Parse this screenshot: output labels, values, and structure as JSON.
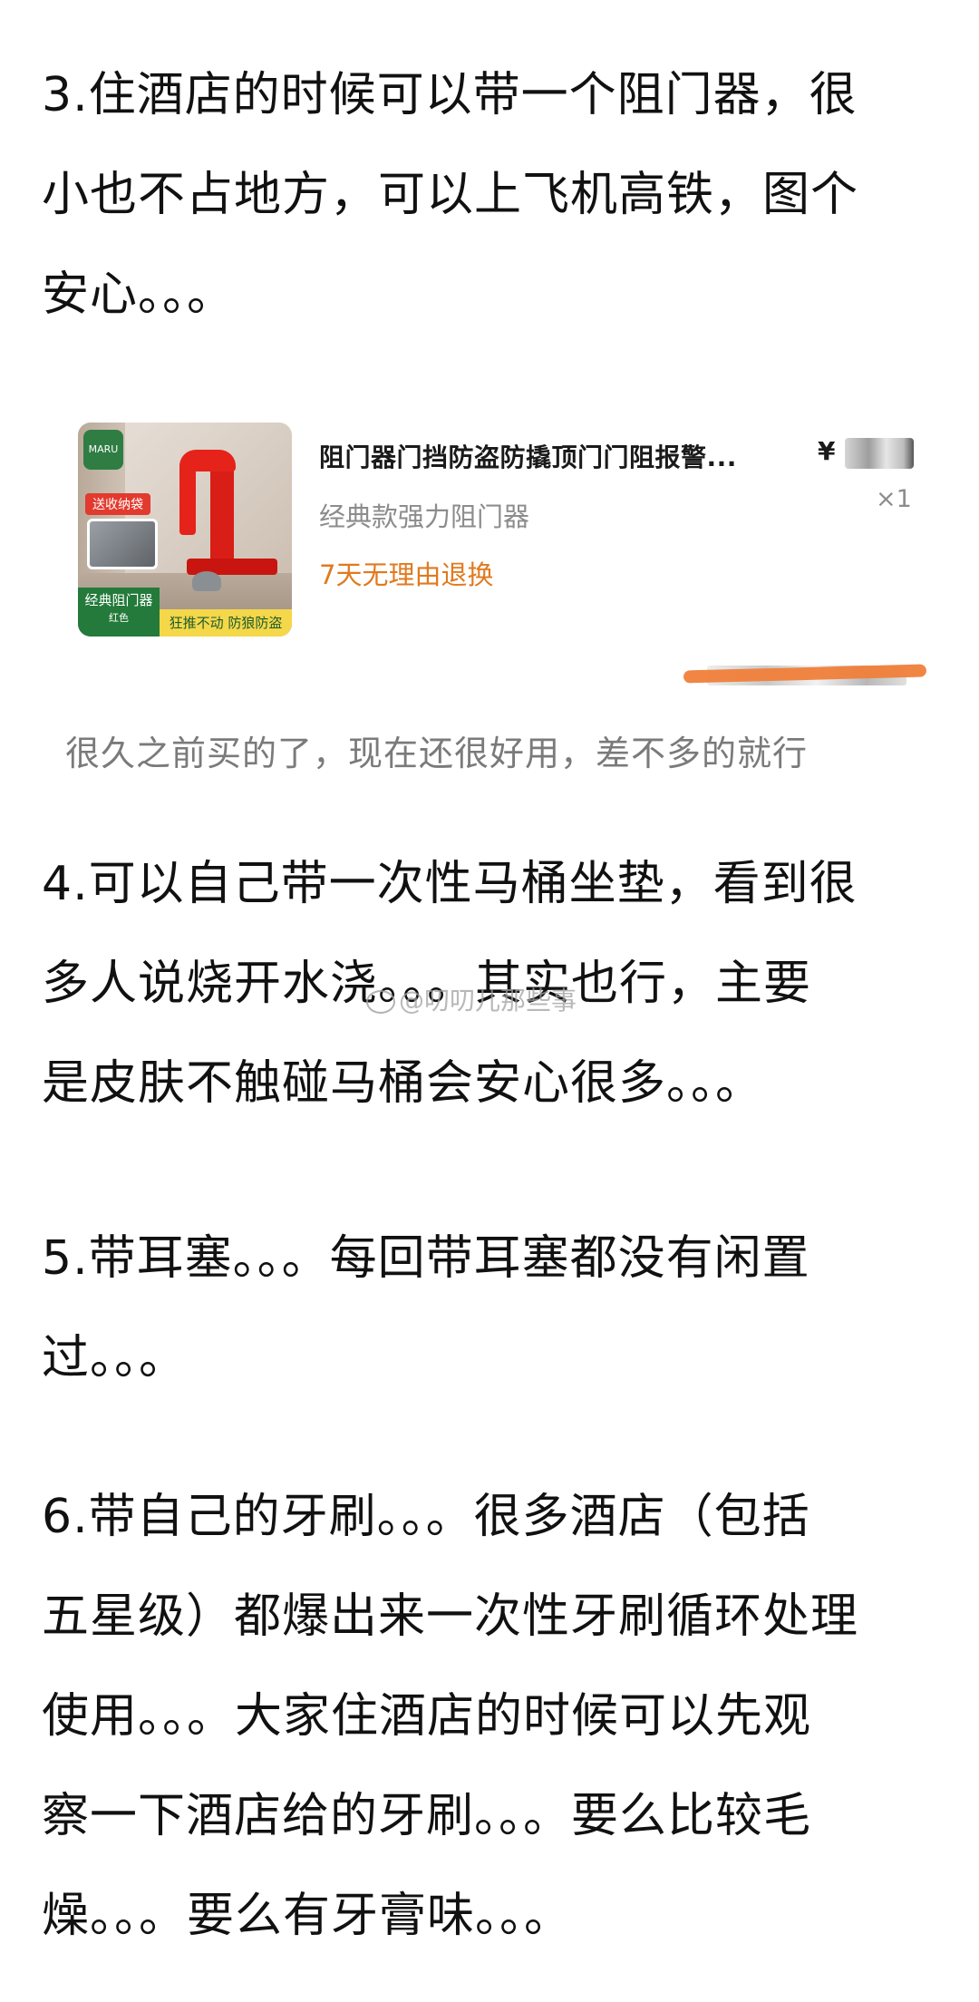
{
  "paragraphs": {
    "p3": "3.住酒店的时候可以带一个阻门器，很\n小也不占地方，可以上飞机高铁，图个\n安心。。。",
    "p4": "4.可以自己带一次性马桶坐垫，看到很\n多人说烧开水浇。。。其实也行，主要\n是皮肤不触碰马桶会安心很多。。。",
    "p5": "5.带耳塞。。。每回带耳塞都没有闲置\n过。。。",
    "p6": "6.带自己的牙刷。。。很多酒店（包括\n五星级）都爆出来一次性牙刷循环处理\n使用。。。大家住酒店的时候可以先观\n察一下酒店给的牙刷。。。要么比较毛\n燥。。。要么有牙膏味。。。"
  },
  "product": {
    "title": "阻门器门挡防盗防撬顶门门阻报警...",
    "price_symbol": "¥",
    "subtitle": "经典款强力阻门器",
    "quantity": "×1",
    "return_policy": "7天无理由退换",
    "thumbnail": {
      "brand": "MARU",
      "tag": "送收纳袋",
      "label_main": "经典阻门器",
      "label_color": "红色",
      "label_right": "狂推不动 防狼防盗"
    }
  },
  "caption": "很久之前买的了，现在还很好用，差不多的就行",
  "watermark": "@叨叨儿那些事"
}
